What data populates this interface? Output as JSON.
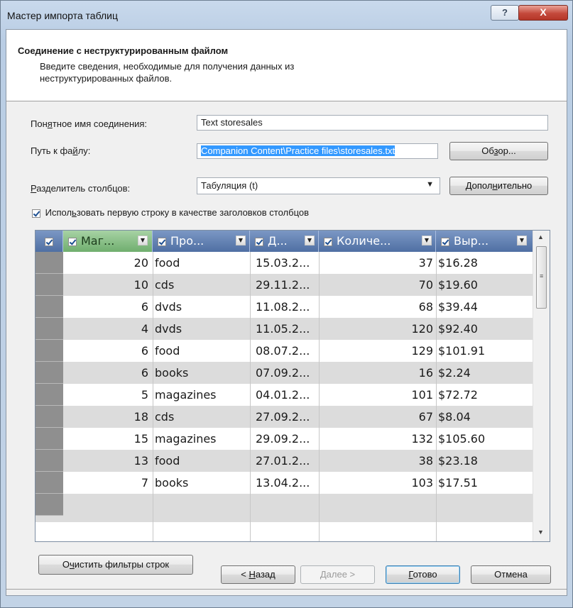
{
  "window": {
    "title": "Мастер импорта таблиц",
    "help_label": "?",
    "close_label": "X"
  },
  "header": {
    "title": "Соединение с неструктурированным файлом",
    "description": "Введите сведения, необходимые для получения данных из неструктурированных файлов."
  },
  "form": {
    "connection_name_label_pre": "Пон",
    "connection_name_label_u": "я",
    "connection_name_label_post": "тное имя соединения:",
    "connection_name_value": "Text storesales",
    "file_path_label_pre": "Путь к фа",
    "file_path_label_u": "й",
    "file_path_label_post": "лу:",
    "file_path_value": "Companion Content\\Practice files\\storesales.txt",
    "browse_pre": "Об",
    "browse_u": "з",
    "browse_post": "ор...",
    "delimiter_label_u": "Р",
    "delimiter_label_post": "азделитель столбцов:",
    "delimiter_value": "Табуляция (t)",
    "advanced_pre": "Допол",
    "advanced_u": "н",
    "advanced_post": "ительно",
    "first_row_pre": "Испол",
    "first_row_u": "ь",
    "first_row_post": "зовать первую строку в качестве заголовков столбцов"
  },
  "grid": {
    "columns": [
      "Маг...",
      "Про...",
      "Д...",
      "Количе...",
      "Выр..."
    ],
    "rows": [
      [
        "20",
        "food",
        "15.03.2...",
        "37",
        "$16.28"
      ],
      [
        "10",
        "cds",
        "29.11.2...",
        "70",
        "$19.60"
      ],
      [
        "6",
        "dvds",
        "11.08.2...",
        "68",
        "$39.44"
      ],
      [
        "4",
        "dvds",
        "11.05.2...",
        "120",
        "$92.40"
      ],
      [
        "6",
        "food",
        "08.07.2...",
        "129",
        "$101.91"
      ],
      [
        "6",
        "books",
        "07.09.2...",
        "16",
        "$2.24"
      ],
      [
        "5",
        "magazines",
        "04.01.2...",
        "101",
        "$72.72"
      ],
      [
        "18",
        "cds",
        "27.09.2...",
        "67",
        "$8.04"
      ],
      [
        "15",
        "magazines",
        "29.09.2...",
        "132",
        "$105.60"
      ],
      [
        "13",
        "food",
        "27.01.2...",
        "38",
        "$23.18"
      ],
      [
        "7",
        "books",
        "13.04.2...",
        "103",
        "$17.51"
      ]
    ]
  },
  "buttons": {
    "clear_filters_pre": "О",
    "clear_filters_u": "ч",
    "clear_filters_post": "истить фильтры строк",
    "back_pre": "< ",
    "back_u": "Н",
    "back_post": "азад",
    "next_u": "Д",
    "next_post": "алее >",
    "finish_u": "Г",
    "finish_post": "отово",
    "cancel": "Отмена"
  }
}
